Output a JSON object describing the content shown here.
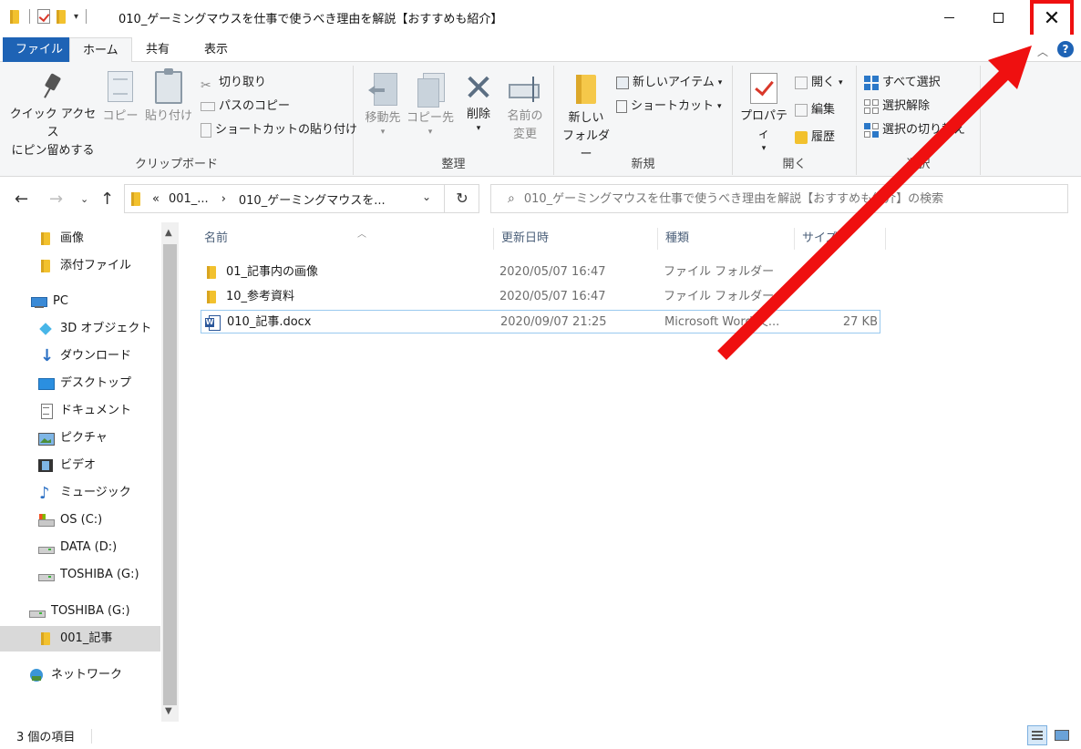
{
  "window": {
    "title": "010_ゲーミングマウスを仕事で使うべき理由を解説【おすすめも紹介】",
    "min_label": "",
    "close_label": "✕"
  },
  "colors": {
    "accent": "#1e63b5",
    "highlight_red": "#ef1010",
    "folder_yellow": "#f2c12e",
    "selection_border": "#99c9ef"
  },
  "tabs": [
    {
      "label": "ファイル"
    },
    {
      "label": "ホーム"
    },
    {
      "label": "共有"
    },
    {
      "label": "表示"
    }
  ],
  "ribbon": {
    "clipboard": {
      "label": "クリップボード",
      "pin_line1": "クイック アクセス",
      "pin_line2": "にピン留めする",
      "copy": "コピー",
      "paste": "貼り付け",
      "cut": "切り取り",
      "copy_path": "パスのコピー",
      "paste_shortcut": "ショートカットの貼り付け"
    },
    "organize": {
      "label": "整理",
      "move_to": "移動先",
      "copy_to": "コピー先",
      "delete": "削除",
      "rename_line1": "名前の",
      "rename_line2": "変更"
    },
    "new": {
      "label": "新規",
      "new_folder_line1": "新しい",
      "new_folder_line2": "フォルダー",
      "new_item": "新しいアイテム",
      "shortcut": "ショートカット"
    },
    "open": {
      "label": "開く",
      "properties": "プロパティ",
      "open": "開く",
      "edit": "編集",
      "history": "履歴"
    },
    "select": {
      "label": "選択",
      "select_all": "すべて選択",
      "select_none": "選択解除",
      "invert": "選択の切り替え"
    }
  },
  "address": {
    "overflow": "«",
    "crumb1": "001_...",
    "sep": "›",
    "crumb2": "010_ゲーミングマウスを...",
    "search_placeholder": "010_ゲーミングマウスを仕事で使うべき理由を解説【おすすめも紹介】の検索"
  },
  "nav_pane": {
    "items": [
      {
        "label": "画像"
      },
      {
        "label": "添付ファイル"
      },
      {
        "label": "PC"
      },
      {
        "label": "3D オブジェクト"
      },
      {
        "label": "ダウンロード"
      },
      {
        "label": "デスクトップ"
      },
      {
        "label": "ドキュメント"
      },
      {
        "label": "ピクチャ"
      },
      {
        "label": "ビデオ"
      },
      {
        "label": "ミュージック"
      },
      {
        "label": "OS (C:)"
      },
      {
        "label": "DATA (D:)"
      },
      {
        "label": "TOSHIBA (G:)"
      },
      {
        "label": "TOSHIBA (G:)"
      },
      {
        "label": "001_記事"
      },
      {
        "label": "ネットワーク"
      }
    ]
  },
  "file_list": {
    "columns": [
      "名前",
      "更新日時",
      "種類",
      "サイズ"
    ],
    "rows": [
      {
        "name": "01_記事内の画像",
        "date": "2020/05/07 16:47",
        "type": "ファイル フォルダー",
        "size": ""
      },
      {
        "name": "10_参考資料",
        "date": "2020/05/07 16:47",
        "type": "ファイル フォルダー",
        "size": ""
      },
      {
        "name": "010_記事.docx",
        "date": "2020/09/07 21:25",
        "type": "Microsoft Word 文...",
        "size": "27 KB"
      }
    ]
  },
  "status": {
    "item_count": "3 個の項目"
  },
  "icons": [
    "folder-icon",
    "checkmark-icon",
    "pin-icon",
    "copy-icon",
    "clipboard-icon",
    "scissors-icon",
    "delete-icon",
    "rename-icon",
    "properties-icon",
    "search-icon",
    "refresh-icon",
    "word-doc-icon",
    "drive-icon",
    "network-icon",
    "details-view-icon",
    "large-icons-view-icon",
    "help-icon"
  ]
}
